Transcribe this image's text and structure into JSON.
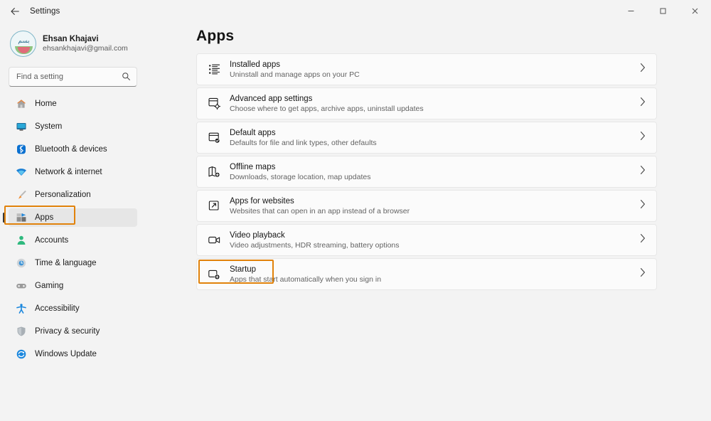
{
  "window": {
    "title": "Settings",
    "back_icon": "arrow-left-icon",
    "controls": {
      "minimize": "minimize-icon",
      "maximize": "maximize-icon",
      "close": "close-icon"
    }
  },
  "accent": {
    "annotation": "#e1820b",
    "selected_bg": "#e6e6e6",
    "page_bg": "#f3f3f3",
    "card_bg": "#fbfbfb"
  },
  "sidebar": {
    "account": {
      "name": "Ehsan Khajavi",
      "email": "ehsankhajavi@gmail.com",
      "avatar": "user-avatar"
    },
    "search": {
      "placeholder": "Find a setting",
      "value": "",
      "icon": "search-icon"
    },
    "items": [
      {
        "label": "Home",
        "icon": "home-icon",
        "selected": false
      },
      {
        "label": "System",
        "icon": "monitor-icon",
        "selected": false
      },
      {
        "label": "Bluetooth & devices",
        "icon": "bluetooth-icon",
        "selected": false
      },
      {
        "label": "Network & internet",
        "icon": "wifi-icon",
        "selected": false
      },
      {
        "label": "Personalization",
        "icon": "paintbrush-icon",
        "selected": false
      },
      {
        "label": "Apps",
        "icon": "apps-icon",
        "selected": true
      },
      {
        "label": "Accounts",
        "icon": "person-icon",
        "selected": false
      },
      {
        "label": "Time & language",
        "icon": "clock-icon",
        "selected": false
      },
      {
        "label": "Gaming",
        "icon": "gamepad-icon",
        "selected": false
      },
      {
        "label": "Accessibility",
        "icon": "accessibility-icon",
        "selected": false
      },
      {
        "label": "Privacy & security",
        "icon": "shield-icon",
        "selected": false
      },
      {
        "label": "Windows Update",
        "icon": "update-icon",
        "selected": false
      }
    ]
  },
  "main": {
    "title": "Apps",
    "rows": [
      {
        "title": "Installed apps",
        "subtitle": "Uninstall and manage apps on your PC",
        "icon": "installed-apps-icon",
        "chevron": "chevron-right-icon",
        "highlighted": false
      },
      {
        "title": "Advanced app settings",
        "subtitle": "Choose where to get apps, archive apps, uninstall updates",
        "icon": "advanced-app-settings-icon",
        "chevron": "chevron-right-icon",
        "highlighted": false
      },
      {
        "title": "Default apps",
        "subtitle": "Defaults for file and link types, other defaults",
        "icon": "default-apps-icon",
        "chevron": "chevron-right-icon",
        "highlighted": false
      },
      {
        "title": "Offline maps",
        "subtitle": "Downloads, storage location, map updates",
        "icon": "offline-maps-icon",
        "chevron": "chevron-right-icon",
        "highlighted": false
      },
      {
        "title": "Apps for websites",
        "subtitle": "Websites that can open in an app instead of a browser",
        "icon": "apps-for-websites-icon",
        "chevron": "chevron-right-icon",
        "highlighted": false
      },
      {
        "title": "Video playback",
        "subtitle": "Video adjustments, HDR streaming, battery options",
        "icon": "video-playback-icon",
        "chevron": "chevron-right-icon",
        "highlighted": false
      },
      {
        "title": "Startup",
        "subtitle": "Apps that start automatically when you sign in",
        "icon": "startup-icon",
        "chevron": "chevron-right-icon",
        "highlighted": true
      }
    ]
  }
}
